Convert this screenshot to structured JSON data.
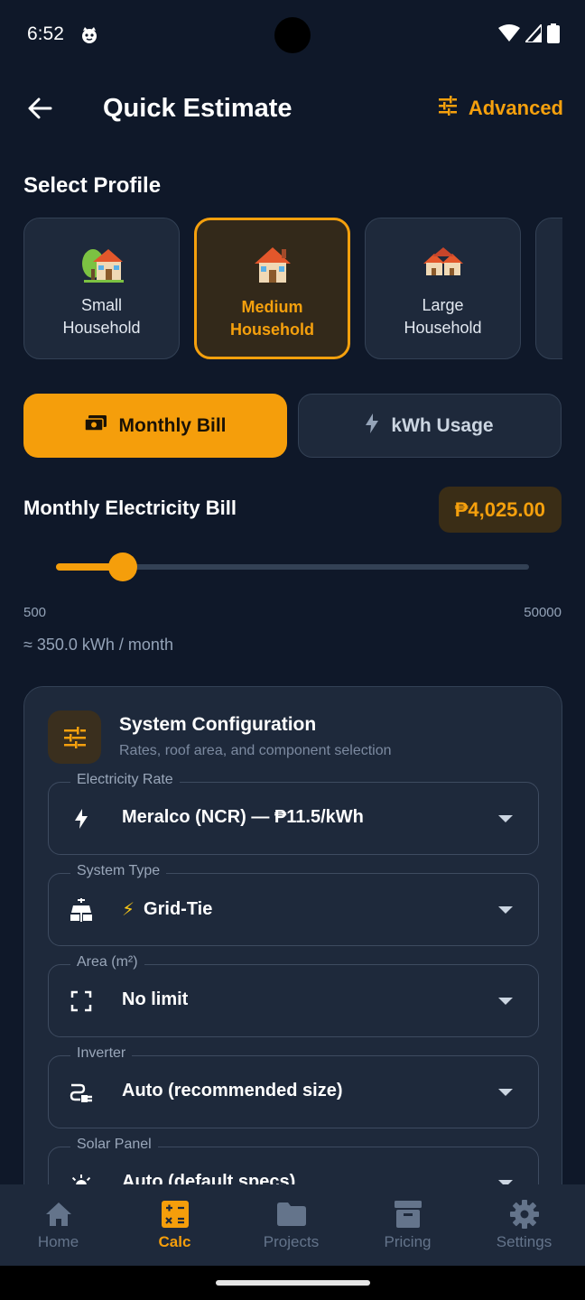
{
  "status": {
    "time": "6:52",
    "notif_icon": "cat-face-icon"
  },
  "appbar": {
    "title": "Quick Estimate",
    "advanced_label": "Advanced"
  },
  "profile_section": {
    "title": "Select Profile",
    "profiles": [
      {
        "label": "Small\nHousehold",
        "icon": "house-with-garden-emoji",
        "selected": false
      },
      {
        "label": "Medium\nHousehold",
        "icon": "house-emoji",
        "selected": true
      },
      {
        "label": "Large\nHousehold",
        "icon": "houses-emoji",
        "selected": false
      }
    ]
  },
  "mode_toggle": {
    "active_label": "Monthly Bill",
    "inactive_label": "kWh Usage"
  },
  "bill": {
    "label": "Monthly Electricity Bill",
    "value": "₱4,025.00",
    "slider_min": "500",
    "slider_max": "50000",
    "slider_value": 4025,
    "kwh_estimate": "≈ 350.0 kWh / month"
  },
  "config": {
    "title": "System Configuration",
    "subtitle": "Rates, roof area, and component selection",
    "fields": [
      {
        "label": "Electricity Rate",
        "value": "Meralco (NCR) — ₱11.5/kWh",
        "icon": "bolt-icon"
      },
      {
        "label": "System Type",
        "value": "Grid-Tie",
        "value_prefix": "⚡",
        "icon": "solar-power-icon"
      },
      {
        "label": "Area (m²)",
        "value": "No limit",
        "icon": "crop-free-icon"
      },
      {
        "label": "Inverter",
        "value": "Auto (recommended size)",
        "icon": "power-plug-icon"
      },
      {
        "label": "Solar Panel",
        "value": "Auto (default specs)",
        "icon": "sun-panel-icon"
      }
    ]
  },
  "nav": {
    "items": [
      {
        "label": "Home",
        "icon": "home-icon",
        "active": false
      },
      {
        "label": "Calc",
        "icon": "calculator-icon",
        "active": true
      },
      {
        "label": "Projects",
        "icon": "folder-icon",
        "active": false
      },
      {
        "label": "Pricing",
        "icon": "archive-box-icon",
        "active": false
      },
      {
        "label": "Settings",
        "icon": "gear-icon",
        "active": false
      }
    ]
  },
  "colors": {
    "accent": "#f59e0b",
    "background": "#0f1829",
    "card": "#1e293b",
    "muted": "#64748b"
  }
}
